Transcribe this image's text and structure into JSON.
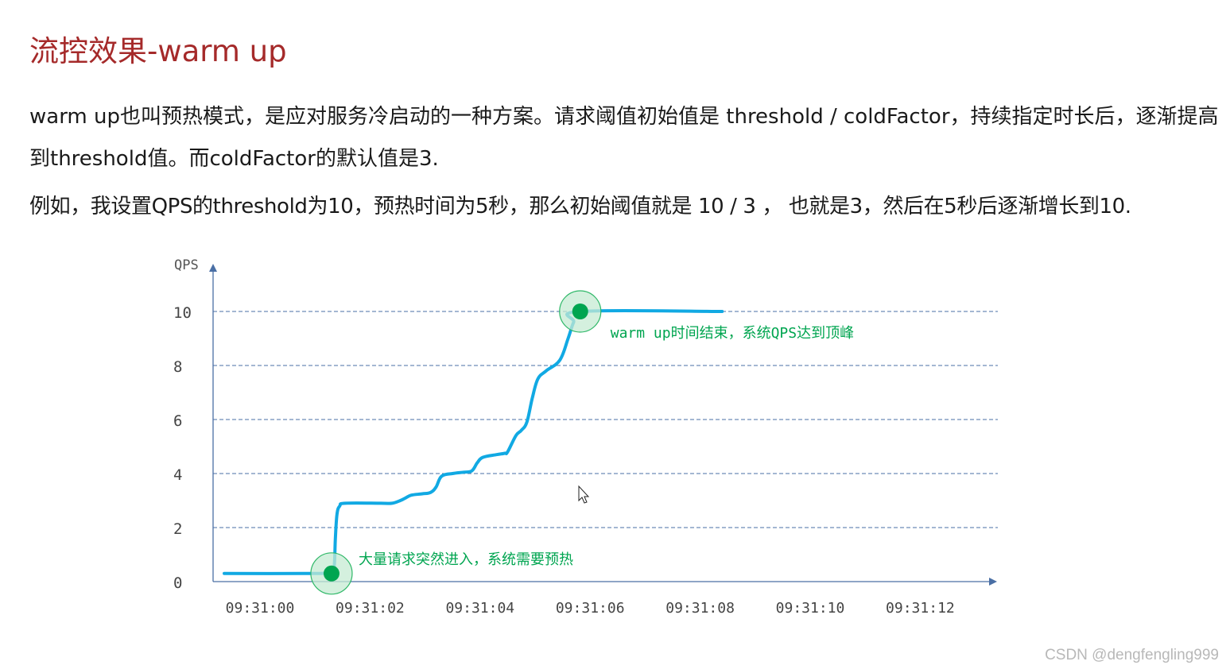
{
  "slide": {
    "title": "流控效果-warm up",
    "paragraph1": "warm up也叫预热模式，是应对服务冷启动的一种方案。请求阈值初始值是 threshold / coldFactor，持续指定时长后，逐渐提高到threshold值。而coldFactor的默认值是3.",
    "paragraph2": "例如，我设置QPS的threshold为10，预热时间为5秒，那么初始阈值就是 10 / 3 ， 也就是3，然后在5秒后逐渐增长到10."
  },
  "chart_data": {
    "type": "line",
    "ylabel": "QPS",
    "xlabel": "",
    "ylim": [
      0,
      11.5
    ],
    "yticks": [
      "0",
      "2",
      "4",
      "6",
      "8",
      "10"
    ],
    "xticks": [
      "09:31:00",
      "09:31:02",
      "09:31:04",
      "09:31:06",
      "09:31:08",
      "09:31:10",
      "09:31:12"
    ],
    "grid": "horizontal dashed",
    "series": [
      {
        "color": "#11a9e3",
        "points": [
          [
            -0.65,
            0.3
          ],
          [
            0.95,
            0.3
          ],
          [
            1.2,
            0.32
          ],
          [
            1.3,
            0.35
          ],
          [
            1.35,
            0.6
          ],
          [
            1.37,
            1.6
          ],
          [
            1.4,
            2.5
          ],
          [
            1.45,
            2.8
          ],
          [
            1.55,
            2.9
          ],
          [
            2.2,
            2.9
          ],
          [
            2.4,
            2.9
          ],
          [
            2.55,
            3.0
          ],
          [
            2.65,
            3.1
          ],
          [
            2.75,
            3.2
          ],
          [
            2.95,
            3.25
          ],
          [
            3.1,
            3.3
          ],
          [
            3.2,
            3.5
          ],
          [
            3.3,
            3.9
          ],
          [
            3.5,
            4.0
          ],
          [
            3.7,
            4.05
          ],
          [
            3.85,
            4.1
          ],
          [
            3.95,
            4.4
          ],
          [
            4.05,
            4.6
          ],
          [
            4.3,
            4.7
          ],
          [
            4.45,
            4.75
          ],
          [
            4.5,
            4.8
          ],
          [
            4.65,
            5.4
          ],
          [
            4.75,
            5.6
          ],
          [
            4.85,
            5.9
          ],
          [
            4.95,
            6.8
          ],
          [
            5.05,
            7.5
          ],
          [
            5.2,
            7.8
          ],
          [
            5.45,
            8.2
          ],
          [
            5.6,
            9.0
          ],
          [
            5.7,
            9.6
          ],
          [
            5.82,
            10.0
          ],
          [
            8.4,
            10.0
          ]
        ]
      }
    ],
    "markers": [
      {
        "x": 1.3,
        "y": 0.3,
        "color": "#00a550"
      },
      {
        "x": 5.82,
        "y": 10.0,
        "color": "#00a550"
      }
    ],
    "annotations": [
      {
        "text": "大量请求突然进入，系统需要预热",
        "color": "#00a550"
      },
      {
        "text": "warm up时间结束，系统QPS达到顶峰",
        "color": "#00a550"
      }
    ]
  },
  "footer": {
    "watermark": "CSDN @dengfengling999"
  }
}
